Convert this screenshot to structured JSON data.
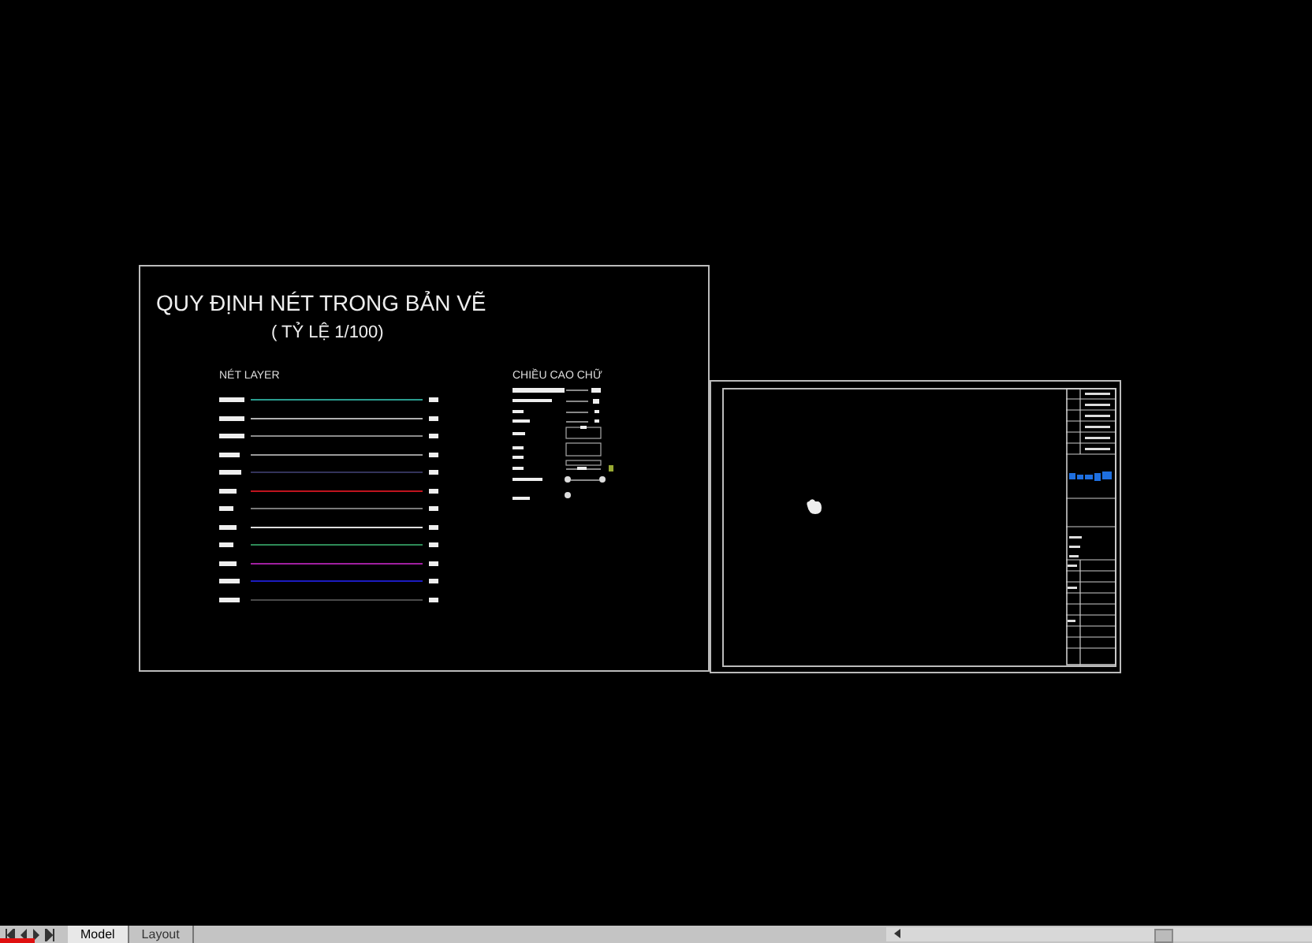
{
  "drawing": {
    "title": "QUY ĐỊNH NÉT TRONG BẢN VẼ",
    "subtitle": "( TỶ LỆ 1/100)",
    "layer_heading": "NÉT LAYER",
    "layer_lines": [
      {
        "color": "#2a9d8f"
      },
      {
        "color": "#b0b0b0"
      },
      {
        "color": "#8a8a8a"
      },
      {
        "color": "#9a9a9a"
      },
      {
        "color": "#33335a"
      },
      {
        "color": "#c0141e"
      },
      {
        "color": "#7a7a7a"
      },
      {
        "color": "#dddddd"
      },
      {
        "color": "#2e8b57"
      },
      {
        "color": "#a020a0"
      },
      {
        "color": "#1c1cc0"
      },
      {
        "color": "#4a4a4a"
      }
    ],
    "text_height_heading": "CHIỀU CAO CHỮ"
  },
  "tabs": [
    {
      "label": "Model",
      "selected": true
    },
    {
      "label": "Layout",
      "selected": false
    }
  ]
}
